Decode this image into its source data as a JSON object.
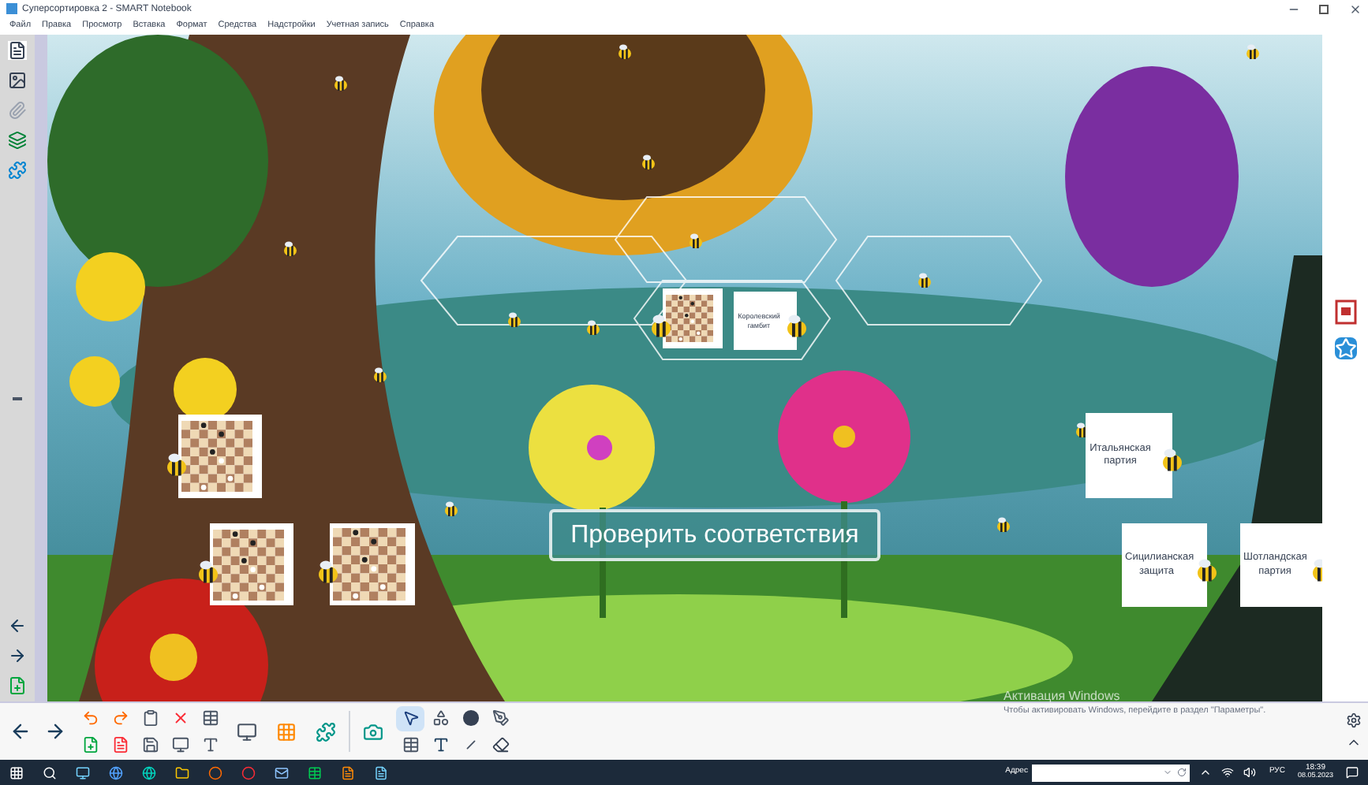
{
  "window": {
    "title": "Суперсортировка 2 - SMART Notebook"
  },
  "menu": [
    "Файл",
    "Правка",
    "Просмотр",
    "Вставка",
    "Формат",
    "Средства",
    "Надстройки",
    "Учетная запись",
    "Справка"
  ],
  "cards": [
    {
      "kind": "board"
    },
    {
      "kind": "text",
      "text": "Королевский гамбит"
    },
    {
      "kind": "board"
    },
    {
      "kind": "board"
    },
    {
      "kind": "board"
    },
    {
      "kind": "text",
      "text": "Итальянская партия"
    },
    {
      "kind": "text",
      "text": "Сицилианская защита"
    },
    {
      "kind": "text",
      "text": "Шотландская партия"
    }
  ],
  "check_button": "Проверить соответствия",
  "activation": {
    "title": "Активация Windows",
    "text": "Чтобы активировать Windows, перейдите в раздел \"Параметры\"."
  },
  "taskbar": {
    "address_label": "Адрес",
    "language": "РУС",
    "time": "18:39",
    "date": "08.05.2023"
  }
}
